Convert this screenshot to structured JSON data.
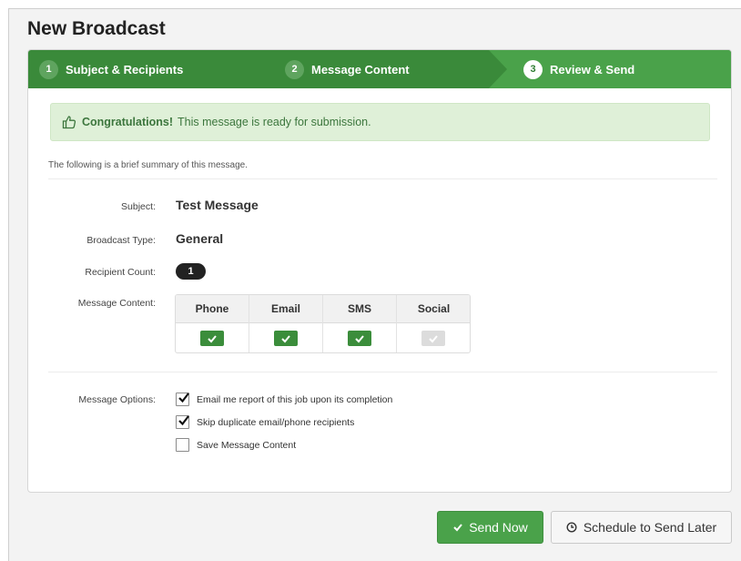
{
  "page": {
    "title": "New Broadcast"
  },
  "steps": [
    {
      "number": "1",
      "label": "Subject & Recipients",
      "state": "complete"
    },
    {
      "number": "2",
      "label": "Message Content",
      "state": "complete"
    },
    {
      "number": "3",
      "label": "Review & Send",
      "state": "active"
    }
  ],
  "alert": {
    "icon": "thumbs-up-icon",
    "strong": "Congratulations!",
    "text": "This message is ready for submission."
  },
  "summary": {
    "intro": "The following is a brief summary of this message.",
    "subject_label": "Subject:",
    "subject_value": "Test Message",
    "type_label": "Broadcast Type:",
    "type_value": "General",
    "count_label": "Recipient Count:",
    "count_value": "1",
    "content_label": "Message Content:"
  },
  "channels": [
    {
      "name": "Phone",
      "enabled": true
    },
    {
      "name": "Email",
      "enabled": true
    },
    {
      "name": "SMS",
      "enabled": true
    },
    {
      "name": "Social",
      "enabled": false
    }
  ],
  "options": {
    "label": "Message Options:",
    "items": [
      {
        "label": "Email me report of this job upon its completion",
        "checked": true
      },
      {
        "label": "Skip duplicate email/phone recipients",
        "checked": true
      },
      {
        "label": "Save Message Content",
        "checked": false
      }
    ]
  },
  "actions": {
    "send_now": "Send Now",
    "schedule": "Schedule to Send Later"
  },
  "colors": {
    "primary_green": "#4aa24a",
    "dark_green": "#3a8a3a",
    "alert_bg": "#dff0d8"
  }
}
